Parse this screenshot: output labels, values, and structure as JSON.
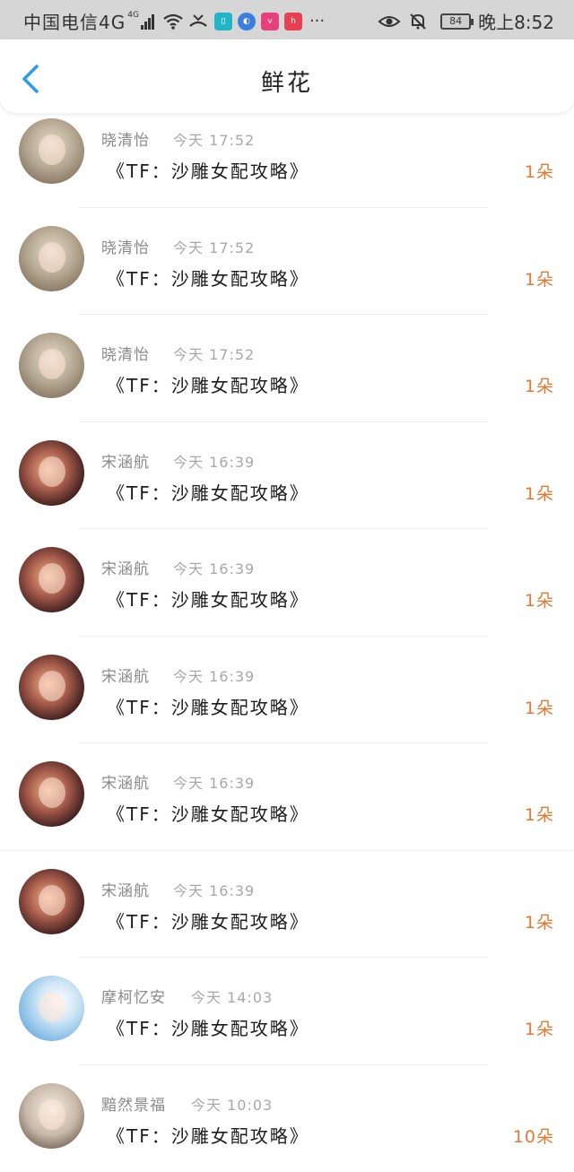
{
  "status_bar": {
    "carrier": "中国电信4G",
    "network_badge": "4G",
    "battery": "84",
    "time": "晚上8:52",
    "icons": [
      "signal-icon",
      "wifi-icon",
      "missed-call-icon",
      "book-app-icon",
      "browser-app-icon",
      "vivo-app-icon",
      "huawei-app-icon",
      "more-icon",
      "eye-icon",
      "mute-icon",
      "battery-icon"
    ],
    "more": "···"
  },
  "header": {
    "title": "鲜花",
    "back_icon": "chevron-left-icon",
    "accent": "#2b9bf0"
  },
  "colors": {
    "count": "#e07a35",
    "name": "#8a8a8a",
    "book": "#1d1d1d"
  },
  "list": {
    "items": [
      {
        "name": "晓清怡",
        "time": "今天 17:52",
        "book": "《TF：沙雕女配攻略》",
        "count": "1朵"
      },
      {
        "name": "晓清怡",
        "time": "今天 17:52",
        "book": "《TF：沙雕女配攻略》",
        "count": "1朵"
      },
      {
        "name": "晓清怡",
        "time": "今天 17:52",
        "book": "《TF：沙雕女配攻略》",
        "count": "1朵"
      },
      {
        "name": "宋涵航",
        "time": "今天 16:39",
        "book": "《TF：沙雕女配攻略》",
        "count": "1朵"
      },
      {
        "name": "宋涵航",
        "time": "今天 16:39",
        "book": "《TF：沙雕女配攻略》",
        "count": "1朵"
      },
      {
        "name": "宋涵航",
        "time": "今天 16:39",
        "book": "《TF：沙雕女配攻略》",
        "count": "1朵"
      },
      {
        "name": "宋涵航",
        "time": "今天 16:39",
        "book": "《TF：沙雕女配攻略》",
        "count": "1朵"
      },
      {
        "name": "宋涵航",
        "time": "今天 16:39",
        "book": "《TF：沙雕女配攻略》",
        "count": "1朵"
      },
      {
        "name": "摩柯忆安",
        "time": "今天 14:03",
        "book": "《TF：沙雕女配攻略》",
        "count": "1朵"
      },
      {
        "name": "黯然景福",
        "time": "今天 10:03",
        "book": "《TF：沙雕女配攻略》",
        "count": "10朵"
      }
    ]
  }
}
